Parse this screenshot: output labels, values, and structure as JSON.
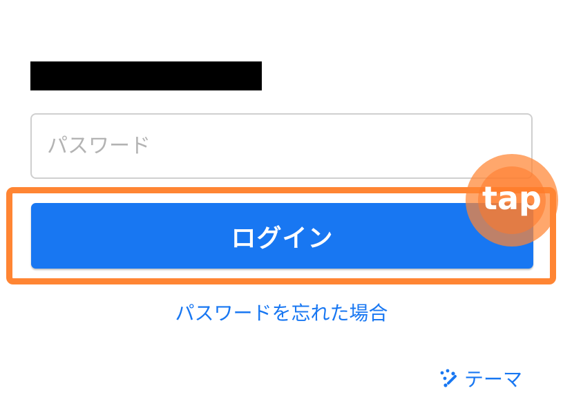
{
  "login_form": {
    "password_placeholder": "パスワード",
    "password_value": "",
    "login_button_label": "ログイン",
    "forgot_password_link": "パスワードを忘れた場合",
    "theme_label": "テーマ",
    "theme_icon": "sparkle-dots-icon"
  },
  "tap_indicator": {
    "label": "tap"
  },
  "colors": {
    "primary": "#1877f2",
    "highlight": "#ff8533",
    "redaction": "#000000"
  }
}
